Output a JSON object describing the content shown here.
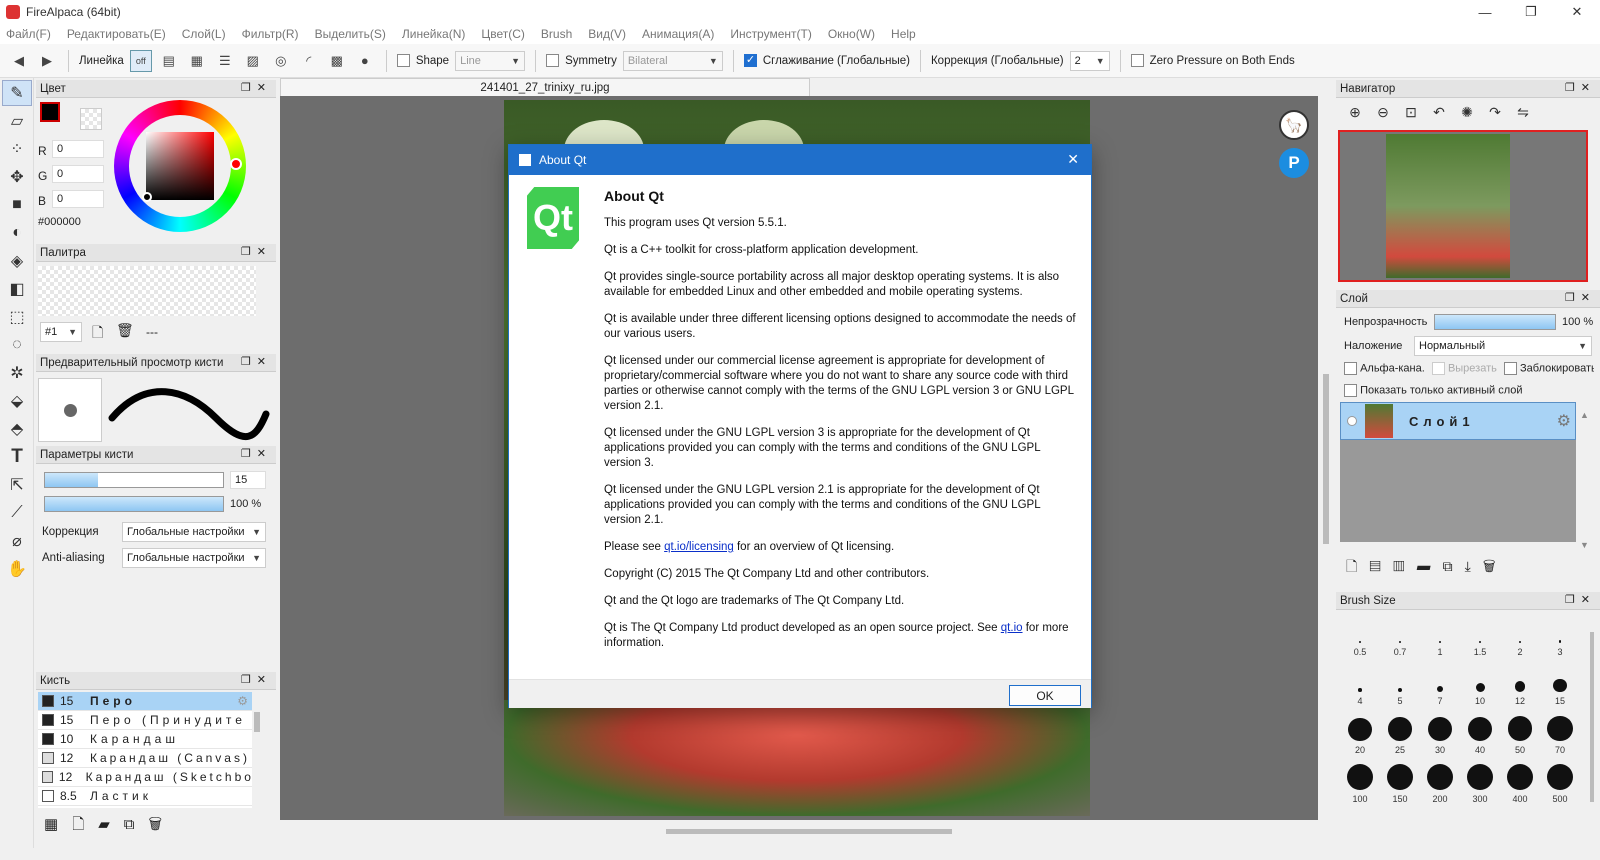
{
  "window": {
    "title": "FireAlpaca (64bit)"
  },
  "menu": [
    "Файл(F)",
    "Редактировать(E)",
    "Слой(L)",
    "Фильтр(R)",
    "Выделить(S)",
    "Линейка(N)",
    "Цвет(C)",
    "Brush",
    "Вид(V)",
    "Анимация(A)",
    "Инструмент(T)",
    "Окно(W)",
    "Help"
  ],
  "toolbar": {
    "ruler_label": "Линейка",
    "shape_label": "Shape",
    "shape_value": "Line",
    "symmetry_label": "Symmetry",
    "symmetry_value": "Bilateral",
    "smoothing_label": "Сглаживание (Глобальные)",
    "correction_label": "Коррекция (Глобальные)",
    "correction_value": "2",
    "zero_pressure_label": "Zero Pressure on Both Ends"
  },
  "color_panel": {
    "title": "Цвет",
    "r_label": "R",
    "r": "0",
    "g_label": "G",
    "g": "0",
    "b_label": "B",
    "b": "0",
    "hex": "#000000"
  },
  "palette_panel": {
    "title": "Палитра",
    "page": "#1",
    "dash": "---"
  },
  "brush_preview_panel": {
    "title": "Предварительный просмотр кисти"
  },
  "brush_params_panel": {
    "title": "Параметры кисти",
    "size_value": "15",
    "opacity_value": "100 %",
    "correction_label": "Коррекция",
    "correction_value": "Глобальные настройки",
    "aa_label": "Anti-aliasing",
    "aa_value": "Глобальные настройки"
  },
  "brush_panel": {
    "title": "Кисть",
    "items": [
      {
        "size": "15",
        "name": "Перо",
        "swatch": "#222222"
      },
      {
        "size": "15",
        "name": "Перо (Принудите",
        "swatch": "#222222"
      },
      {
        "size": "10",
        "name": "Карандаш",
        "swatch": "#222222"
      },
      {
        "size": "12",
        "name": "Карандаш (Canvas)",
        "swatch": "#dddddd"
      },
      {
        "size": "12",
        "name": "Карандаш (Sketchbook",
        "swatch": "#dddddd"
      },
      {
        "size": "8.5",
        "name": "Ластик",
        "swatch": "#ffffff"
      }
    ]
  },
  "document": {
    "tab": "241401_27_trinixy_ru.jpg"
  },
  "dialog": {
    "title": "About Qt",
    "heading": "About Qt",
    "logo_text": "Qt",
    "p1": "This program uses Qt version 5.5.1.",
    "p2": "Qt is a C++ toolkit for cross-platform application development.",
    "p3": "Qt provides single-source portability across all major desktop operating systems. It is also available for embedded Linux and other embedded and mobile operating systems.",
    "p4": "Qt is available under three different licensing options designed to accommodate the needs of our various users.",
    "p5": "Qt licensed under our commercial license agreement is appropriate for development of proprietary/commercial software where you do not want to share any source code with third parties or otherwise cannot comply with the terms of the GNU LGPL version 3 or GNU LGPL version 2.1.",
    "p6": "Qt licensed under the GNU LGPL version 3 is appropriate for the development of Qt applications provided you can comply with the terms and conditions of the GNU LGPL version 3.",
    "p7": "Qt licensed under the GNU LGPL version 2.1 is appropriate for the development of Qt applications provided you can comply with the terms and conditions of the GNU LGPL version 2.1.",
    "p8_pre": "Please see ",
    "p8_link": "qt.io/licensing",
    "p8_post": " for an overview of Qt licensing.",
    "p9": "Copyright (C) 2015 The Qt Company Ltd and other contributors.",
    "p10": "Qt and the Qt logo are trademarks of The Qt Company Ltd.",
    "p11_pre": "Qt is The Qt Company Ltd product developed as an open source project. See ",
    "p11_link": "qt.io",
    "p11_post": " for more information.",
    "ok": "OK"
  },
  "navigator": {
    "title": "Навигатор"
  },
  "layer_panel": {
    "title": "Слой",
    "opacity_label": "Непрозрачность",
    "opacity_value": "100 %",
    "opacity_fraction": 1.0,
    "blend_label": "Наложение",
    "blend_value": "Нормальный",
    "alpha_label": "Альфа-кана.",
    "clip_label": "Вырезать",
    "lock_label": "Заблокировать",
    "show_active_label": "Показать только активный слой",
    "layer_name": "Слой1"
  },
  "brush_size_panel": {
    "title": "Brush Size",
    "sizes": [
      "0.5",
      "0.7",
      "1",
      "1.5",
      "2",
      "3",
      "4",
      "5",
      "7",
      "10",
      "12",
      "15",
      "20",
      "25",
      "30",
      "40",
      "50",
      "70",
      "100",
      "150",
      "200",
      "300",
      "400",
      "500"
    ]
  },
  "colors": {
    "accent": "#1f6fcb",
    "qt_green": "#41cd52",
    "selection": "#a9d3f5"
  }
}
